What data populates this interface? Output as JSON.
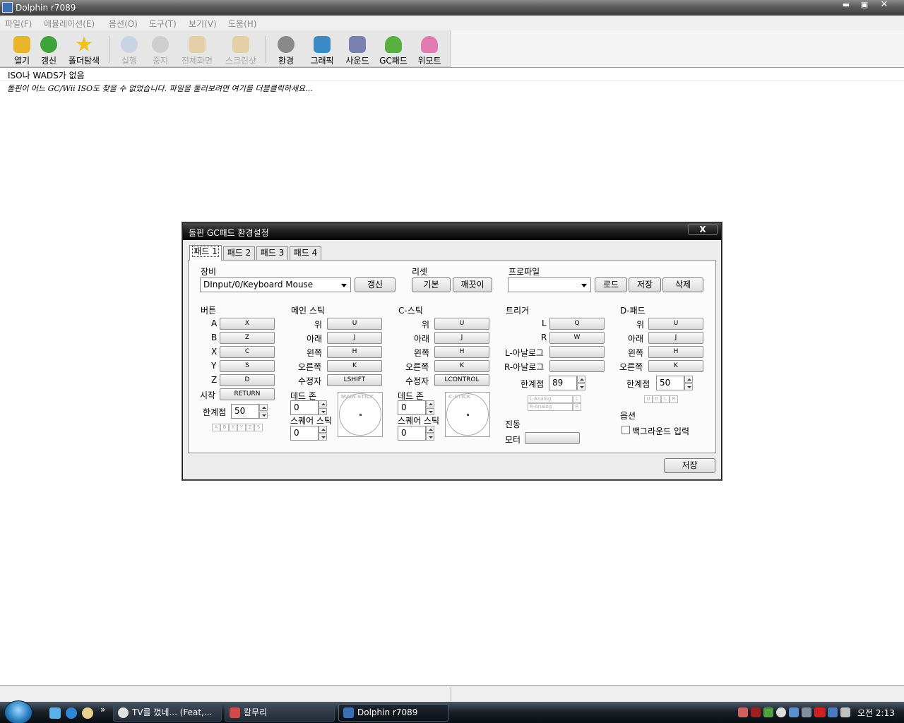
{
  "window": {
    "title": "Dolphin r7089"
  },
  "menu": [
    "파일(F)",
    "에뮬레이션(E)",
    "옵션(O)",
    "도구(T)",
    "보기(V)",
    "도움(H)"
  ],
  "toolbar": {
    "open": "열기",
    "refresh": "갱신",
    "browse": "폴더탐색",
    "play": "실행",
    "stop": "중지",
    "fullscreen": "전체화면",
    "screenshot": "스크린샷",
    "config": "환경",
    "graphics": "그래픽",
    "sound": "사운드",
    "gcpad": "GC패드",
    "wiimote": "위모트"
  },
  "gamelist": {
    "header": "ISO나 WADS가 없음",
    "message": "돌핀이 어느 GC/Wii ISO도 찾을 수 없었습니다. 파일을 둘러보려면 여기를 더블클릭하세요..."
  },
  "dialog": {
    "title": "돌핀 GC패드 환경설정",
    "close": "X",
    "tabs": [
      "패드 1",
      "패드 2",
      "패드 3",
      "패드 4"
    ],
    "device_label": "장비",
    "device_value": "DInput/0/Keyboard Mouse",
    "device_refresh": "갱신",
    "reset_label": "리셋",
    "reset_default": "기본",
    "reset_clear": "깨끗이",
    "profile_label": "프로파일",
    "profile_value": "",
    "profile_load": "로드",
    "profile_save": "저장",
    "profile_delete": "삭제",
    "buttons": {
      "label": "버튼",
      "rows": [
        {
          "name": "A",
          "key": "X"
        },
        {
          "name": "B",
          "key": "Z"
        },
        {
          "name": "X",
          "key": "C"
        },
        {
          "name": "Y",
          "key": "S"
        },
        {
          "name": "Z",
          "key": "D"
        },
        {
          "name": "시작",
          "key": "RETURN"
        }
      ],
      "threshold_label": "한계점",
      "threshold_value": "50",
      "indicator": [
        "A",
        "B",
        "X",
        "Y",
        "Z",
        "S"
      ]
    },
    "main_stick": {
      "label": "메인 스틱",
      "rows": [
        {
          "name": "위",
          "key": "U"
        },
        {
          "name": "아래",
          "key": "J"
        },
        {
          "name": "왼쪽",
          "key": "H"
        },
        {
          "name": "오른쪽",
          "key": "K"
        },
        {
          "name": "수정자",
          "key": "LSHIFT"
        }
      ],
      "deadzone_label": "데드 존",
      "deadzone_value": "0",
      "square_label": "스퀘어 스틱",
      "square_value": "0",
      "caption": "MAIN STICK"
    },
    "c_stick": {
      "label": "C-스틱",
      "rows": [
        {
          "name": "위",
          "key": "U"
        },
        {
          "name": "아래",
          "key": "J"
        },
        {
          "name": "왼쪽",
          "key": "H"
        },
        {
          "name": "오른쪽",
          "key": "K"
        },
        {
          "name": "수정자",
          "key": "LCONTROL"
        }
      ],
      "deadzone_label": "데드 존",
      "deadzone_value": "0",
      "square_label": "스퀘어 스틱",
      "square_value": "0",
      "caption": "C-STICK"
    },
    "triggers": {
      "label": "트리거",
      "rows": [
        {
          "name": "L",
          "key": "Q"
        },
        {
          "name": "R",
          "key": "W"
        },
        {
          "name": "L-아날로그",
          "key": ""
        },
        {
          "name": "R-아날로그",
          "key": ""
        }
      ],
      "threshold_label": "한계점",
      "threshold_value": "89",
      "bars": [
        {
          "name": "L-Analog",
          "tag": "L"
        },
        {
          "name": "R-Analog",
          "tag": "R"
        }
      ]
    },
    "rumble": {
      "label": "진동",
      "motor_label": "모터",
      "motor_key": ""
    },
    "dpad": {
      "label": "D-패드",
      "rows": [
        {
          "name": "위",
          "key": "U"
        },
        {
          "name": "아래",
          "key": "J"
        },
        {
          "name": "왼쪽",
          "key": "H"
        },
        {
          "name": "오른쪽",
          "key": "K"
        }
      ],
      "threshold_label": "한계점",
      "threshold_value": "50",
      "indicator": [
        "U",
        "D",
        "L",
        "R"
      ]
    },
    "options": {
      "label": "옵션",
      "background_input": "백그라운드 입력"
    },
    "save": "저장"
  },
  "taskbar": {
    "tasks": [
      {
        "label": "TV를 껐네... (Feat,..."
      },
      {
        "label": "칼무리"
      },
      {
        "label": "Dolphin r7089"
      }
    ],
    "clock": "오전 2:13"
  }
}
